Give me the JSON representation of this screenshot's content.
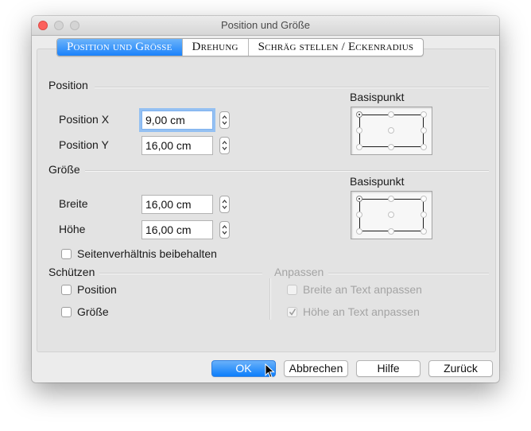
{
  "window": {
    "title": "Position und Größe"
  },
  "tabs": [
    {
      "label": "Position und Grösse",
      "active": true
    },
    {
      "label": "Drehung",
      "active": false
    },
    {
      "label": "Schräg stellen / Eckenradius",
      "active": false
    }
  ],
  "position": {
    "section_label": "Position",
    "x_label": "Position X",
    "x_value": "9,00 cm",
    "y_label": "Position Y",
    "y_value": "16,00 cm",
    "basispunkt_label": "Basispunkt"
  },
  "size": {
    "section_label": "Größe",
    "width_label": "Breite",
    "width_value": "16,00 cm",
    "height_label": "Höhe",
    "height_value": "16,00 cm",
    "basispunkt_label": "Basispunkt",
    "keep_ratio_label": "Seitenverhältnis beibehalten"
  },
  "protect": {
    "section_label": "Schützen",
    "position_label": "Position",
    "size_label": "Größe"
  },
  "fit": {
    "section_label": "Anpassen",
    "width_label": "Breite an Text anpassen",
    "height_label": "Höhe an Text anpassen"
  },
  "buttons": {
    "ok": "OK",
    "cancel": "Abbrechen",
    "help": "Hilfe",
    "reset": "Zurück"
  },
  "colors": {
    "accent": "#1a82fb",
    "close": "#fc605c"
  },
  "icons": {
    "stepper": "stepper-icon",
    "check": "checkmark-icon",
    "pointer": "arrow-pointer-icon"
  }
}
